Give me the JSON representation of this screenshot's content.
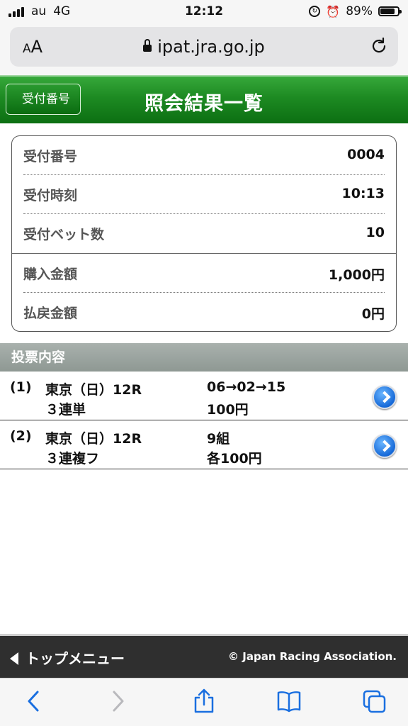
{
  "status": {
    "carrier": "au",
    "network": "4G",
    "time": "12:12",
    "battery_pct": "89%",
    "battery_level": 0.89
  },
  "browser": {
    "text_size": "AA",
    "url": "ipat.jra.go.jp"
  },
  "header": {
    "back_label": "受付番号",
    "title": "照会結果一覧"
  },
  "summary": [
    {
      "label": "受付番号",
      "value": "0004"
    },
    {
      "label": "受付時刻",
      "value": "10:13"
    },
    {
      "label": "受付ベット数",
      "value": "10"
    },
    {
      "label": "購入金額",
      "value": "1,000円"
    },
    {
      "label": "払戻金額",
      "value": "0円"
    }
  ],
  "section": {
    "title": "投票内容"
  },
  "bets": [
    {
      "index": "(1)",
      "race": "東京（日）12R",
      "bet_type": "３連単",
      "combination": "06→02→15",
      "amount": "100円"
    },
    {
      "index": "(2)",
      "race": "東京（日）12R",
      "bet_type": "３連複フ",
      "combination": "9組",
      "amount": "各100円"
    }
  ],
  "footer": {
    "top_menu": "トップメニュー",
    "copyright": "© Japan Racing Association."
  },
  "colors": {
    "header_green": "#1d8a22",
    "link_blue": "#1a6fe0",
    "footer_bg": "#2f2f2f"
  }
}
